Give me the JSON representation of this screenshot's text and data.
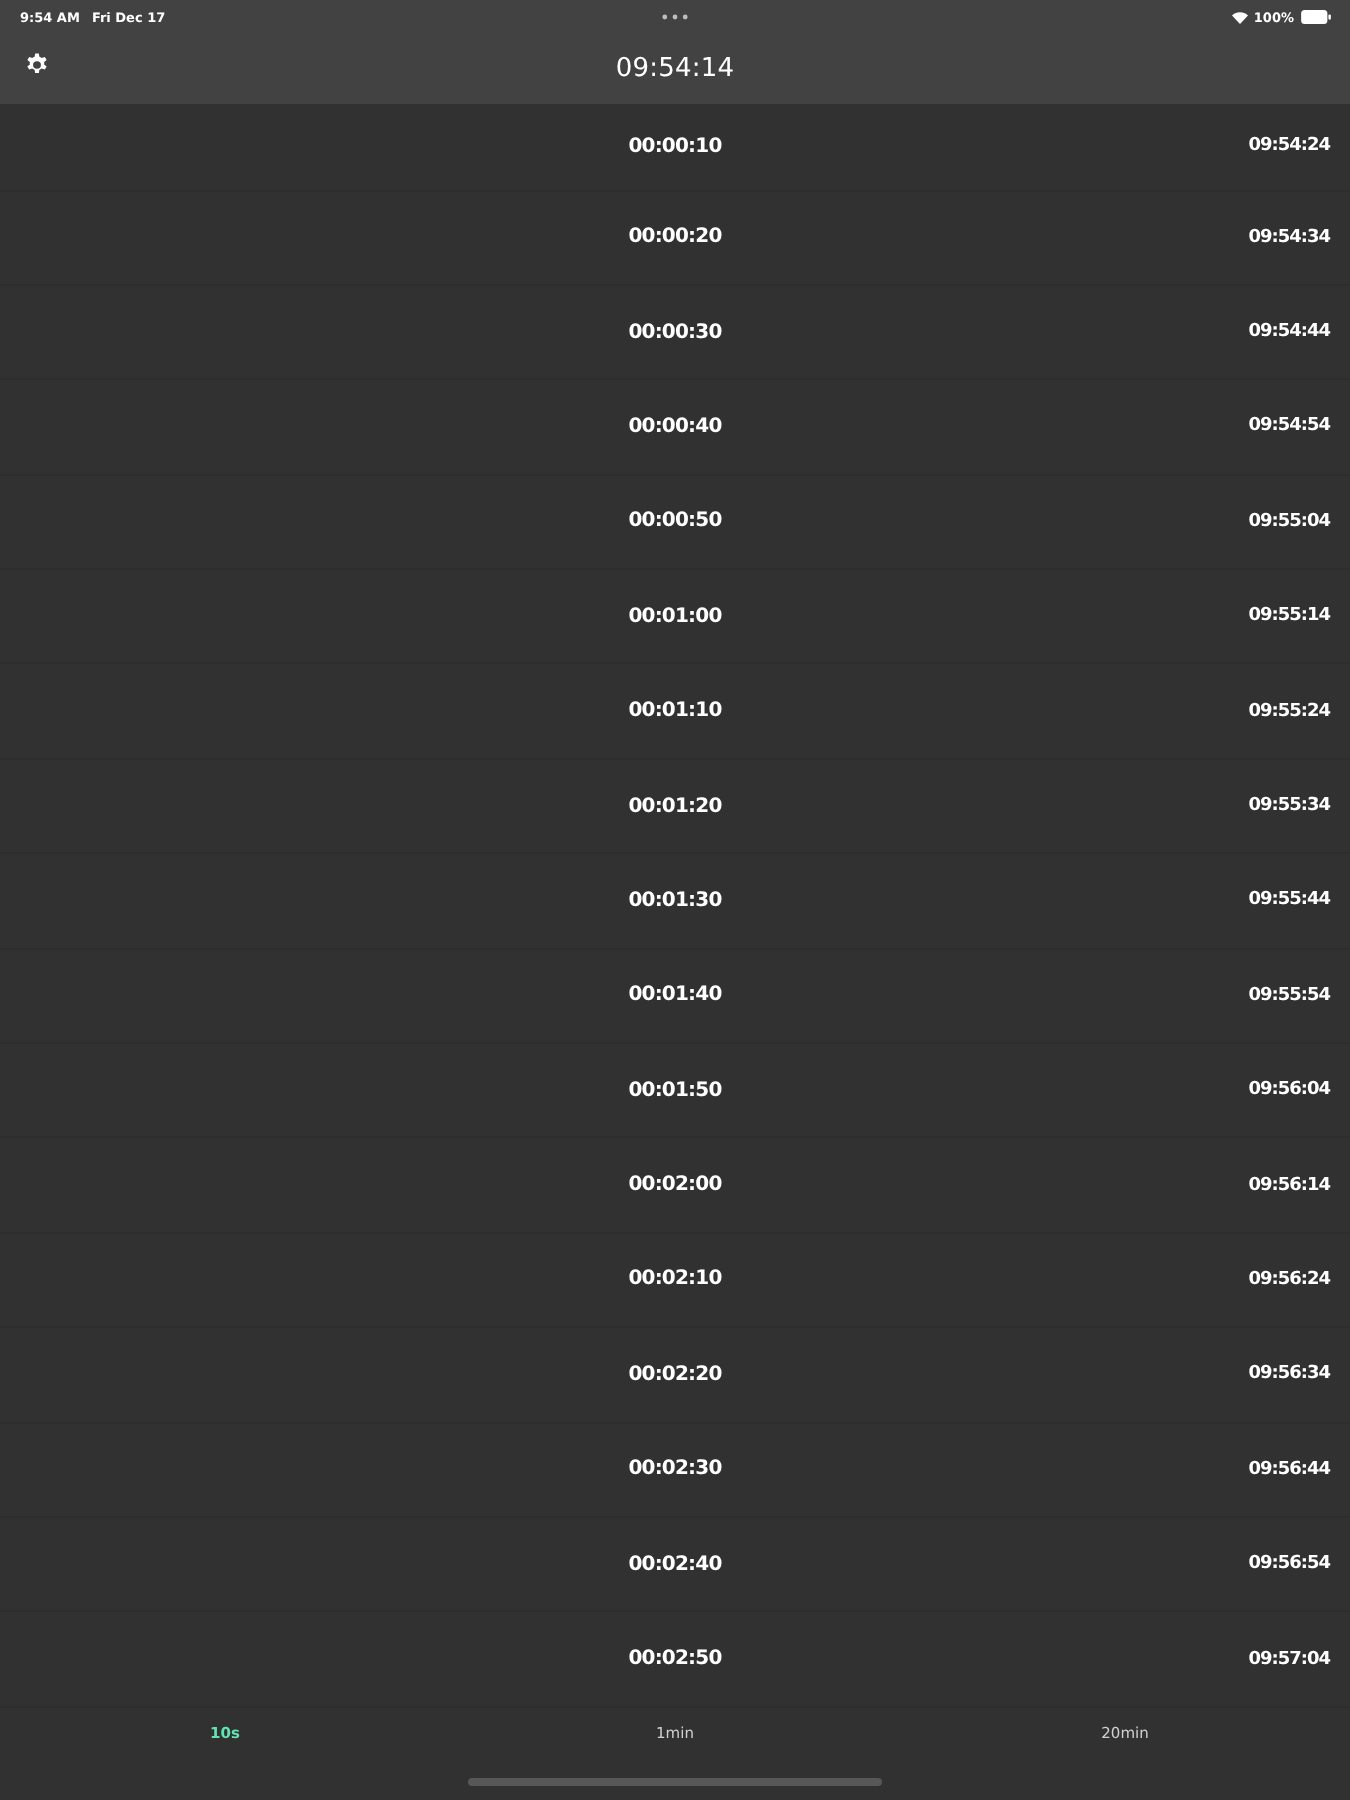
{
  "status_bar": {
    "time": "9:54 AM",
    "date": "Fri Dec 17",
    "battery": "100%"
  },
  "header": {
    "title": "09:54:14"
  },
  "rows": [
    {
      "elapsed": "00:00:10",
      "clock": "09:54:24"
    },
    {
      "elapsed": "00:00:20",
      "clock": "09:54:34"
    },
    {
      "elapsed": "00:00:30",
      "clock": "09:54:44"
    },
    {
      "elapsed": "00:00:40",
      "clock": "09:54:54"
    },
    {
      "elapsed": "00:00:50",
      "clock": "09:55:04"
    },
    {
      "elapsed": "00:01:00",
      "clock": "09:55:14"
    },
    {
      "elapsed": "00:01:10",
      "clock": "09:55:24"
    },
    {
      "elapsed": "00:01:20",
      "clock": "09:55:34"
    },
    {
      "elapsed": "00:01:30",
      "clock": "09:55:44"
    },
    {
      "elapsed": "00:01:40",
      "clock": "09:55:54"
    },
    {
      "elapsed": "00:01:50",
      "clock": "09:56:04"
    },
    {
      "elapsed": "00:02:00",
      "clock": "09:56:14"
    },
    {
      "elapsed": "00:02:10",
      "clock": "09:56:24"
    },
    {
      "elapsed": "00:02:20",
      "clock": "09:56:34"
    },
    {
      "elapsed": "00:02:30",
      "clock": "09:56:44"
    },
    {
      "elapsed": "00:02:40",
      "clock": "09:56:54"
    },
    {
      "elapsed": "00:02:50",
      "clock": "09:57:04"
    }
  ],
  "tabs": [
    {
      "label": "10s",
      "selected": true
    },
    {
      "label": "1min",
      "selected": false
    },
    {
      "label": "20min",
      "selected": false
    }
  ]
}
